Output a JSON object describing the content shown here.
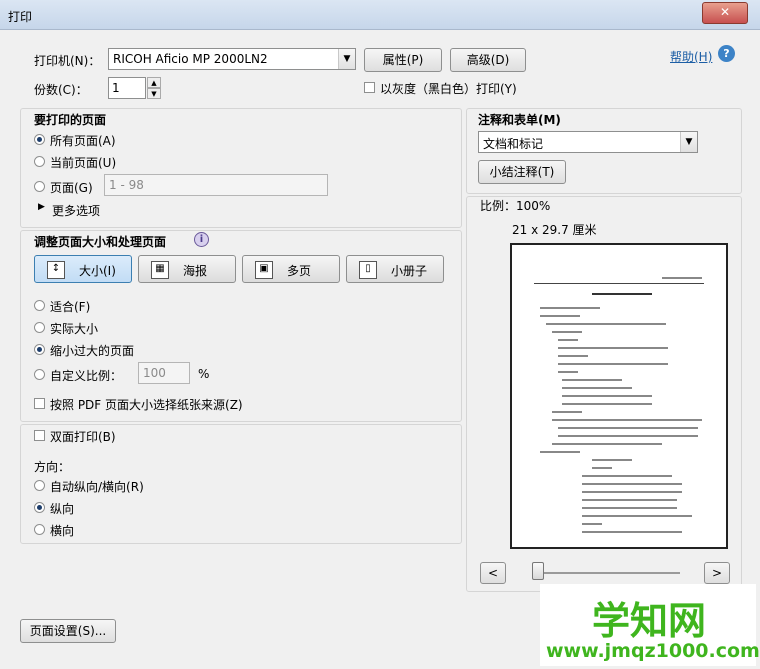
{
  "window": {
    "title": "打印",
    "close": "✕"
  },
  "help": {
    "label": "帮助(H)",
    "icon": "?"
  },
  "printer": {
    "label": "打印机(N)：",
    "value": "RICOH Aficio MP 2000LN2",
    "properties": "属性(P)",
    "advanced": "高级(D)"
  },
  "copies": {
    "label": "份数(C)：",
    "value": "1",
    "grayscale": "以灰度（黑白色）打印(Y)"
  },
  "pages": {
    "heading": "要打印的页面",
    "all": "所有页面(A)",
    "current": "当前页面(U)",
    "range": "页面(G)",
    "range_placeholder": "1 - 98",
    "more": "更多选项"
  },
  "sizing": {
    "heading": "调整页面大小和处理页面",
    "info_icon": "i",
    "size": "大小(I)",
    "poster": "海报",
    "multiple": "多页",
    "booklet": "小册子",
    "fit": "适合(F)",
    "actual": "实际大小",
    "shrink": "缩小过大的页面",
    "custom": "自定义比例：",
    "custom_value": "100",
    "percent": "%",
    "paper_source": "按照 PDF 页面大小选择纸张来源(Z)"
  },
  "duplex": {
    "label": "双面打印(B)"
  },
  "orientation": {
    "label": "方向：",
    "auto": "自动纵向/横向(R)",
    "portrait": "纵向",
    "landscape": "横向"
  },
  "comments": {
    "heading": "注释和表单(M)",
    "value": "文档和标记",
    "summarize": "小结注释(T)"
  },
  "preview": {
    "scale": "比例：100%",
    "dimensions": "21 x 29.7 厘米",
    "prev": "<",
    "next": ">"
  },
  "page_setup": "页面设置(S)...",
  "watermark": {
    "title": "学知网",
    "url": "www.jmqz1000.com"
  }
}
